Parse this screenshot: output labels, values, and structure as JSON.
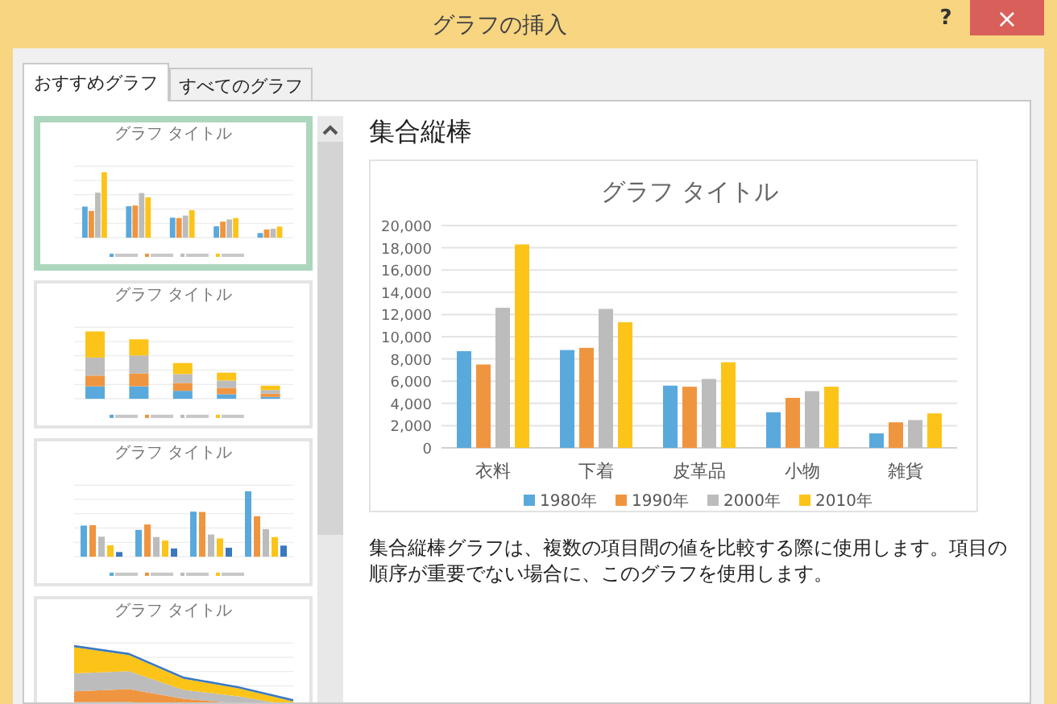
{
  "window": {
    "title": "グラフの挿入",
    "help": "?",
    "close": "×"
  },
  "tabs": [
    {
      "label": "おすすめグラフ",
      "selected": true
    },
    {
      "label": "すべてのグラフ",
      "selected": false
    }
  ],
  "thumbnails": [
    {
      "kind": "clustered",
      "title": "グラフ タイトル",
      "selected": true
    },
    {
      "kind": "stacked",
      "title": "グラフ タイトル",
      "selected": false
    },
    {
      "kind": "by-year",
      "title": "グラフ タイトル",
      "selected": false
    },
    {
      "kind": "area",
      "title": "グラフ タイトル",
      "selected": false
    }
  ],
  "preview": {
    "heading": "集合縦棒",
    "chart_data": {
      "type": "bar",
      "title": "グラフ タイトル",
      "categories": [
        "衣料",
        "下着",
        "皮革品",
        "小物",
        "雑貨"
      ],
      "series": [
        {
          "name": "1980年",
          "color": "#5aa9dc",
          "values": [
            8700,
            8800,
            5600,
            3200,
            1300
          ]
        },
        {
          "name": "1990年",
          "color": "#f0953f",
          "values": [
            7500,
            9000,
            5500,
            4500,
            2300
          ]
        },
        {
          "name": "2000年",
          "color": "#bcbcbc",
          "values": [
            12600,
            12500,
            6200,
            5100,
            2500
          ]
        },
        {
          "name": "2010年",
          "color": "#fcc419",
          "values": [
            18300,
            11300,
            7700,
            5500,
            3100
          ]
        }
      ],
      "ylim": [
        0,
        20000
      ],
      "grid": true,
      "legend": "bottom",
      "yticks": [
        {
          "value": 0,
          "label": "0"
        },
        {
          "value": 2000,
          "label": "2,000"
        },
        {
          "value": 4000,
          "label": "4,000"
        },
        {
          "value": 6000,
          "label": "6,000"
        },
        {
          "value": 8000,
          "label": "8,000"
        },
        {
          "value": 10000,
          "label": "10,000"
        },
        {
          "value": 12000,
          "label": "12,000"
        },
        {
          "value": 14000,
          "label": "14,000"
        },
        {
          "value": 16000,
          "label": "16,000"
        },
        {
          "value": 18000,
          "label": "18,000"
        },
        {
          "value": 20000,
          "label": "20,000"
        }
      ]
    },
    "description": "集合縦棒グラフは、複数の項目間の値を比較する際に使用します。項目の順序が重要でない場合に、このグラフを使用します。"
  }
}
